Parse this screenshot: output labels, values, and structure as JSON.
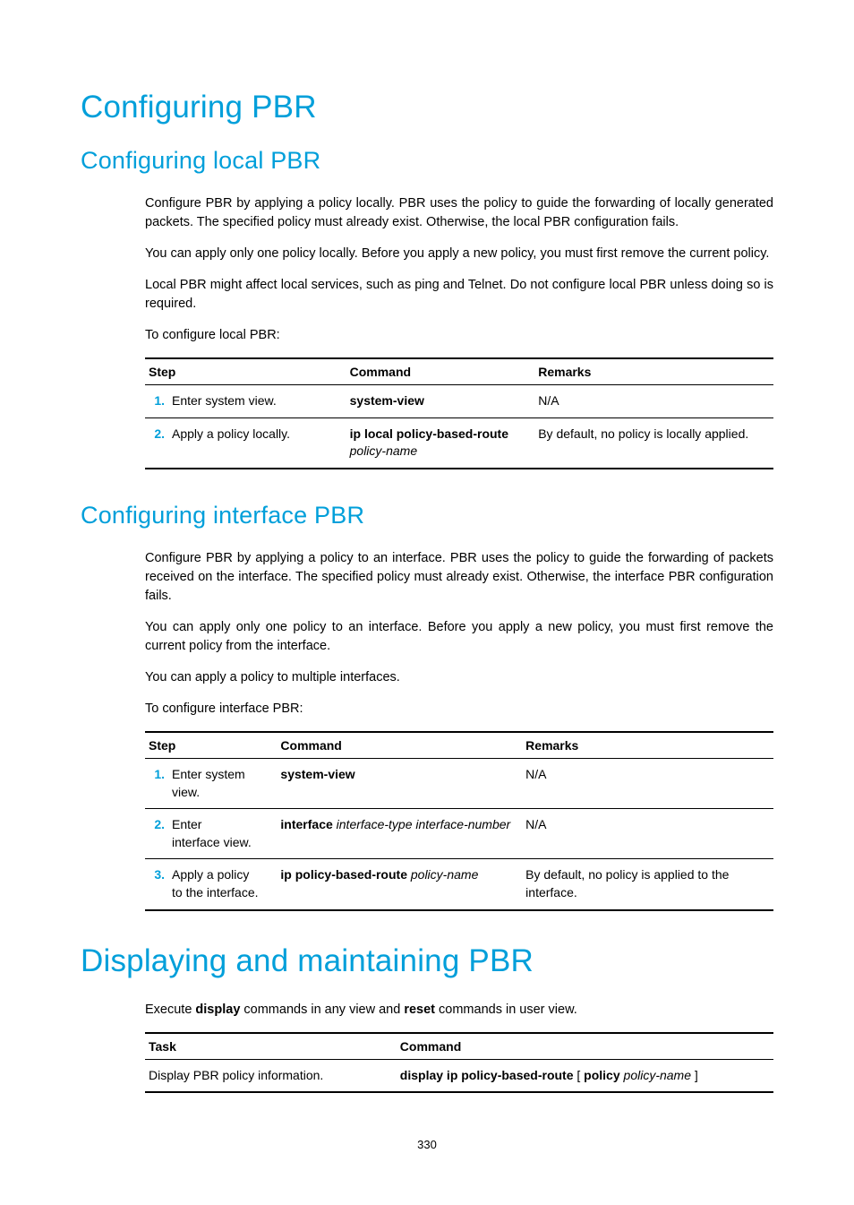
{
  "h1_main": "Configuring PBR",
  "sec1": {
    "heading": "Configuring local PBR",
    "p1": "Configure PBR by applying a policy locally. PBR uses the policy to guide the forwarding of locally generated packets. The specified policy must already exist. Otherwise, the local PBR configuration fails.",
    "p2": "You can apply only one policy locally. Before you apply a new policy, you must first remove the current policy.",
    "p3": "Local PBR might affect local services, such as ping and Telnet. Do not configure local PBR unless doing so is required.",
    "p4": "To configure local PBR:",
    "table": {
      "headers": {
        "c1": "Step",
        "c2": "Command",
        "c3": "Remarks"
      },
      "rows": [
        {
          "num": "1.",
          "step": "Enter system view.",
          "cmd_bold": "system-view",
          "cmd_ital": "",
          "remarks": "N/A"
        },
        {
          "num": "2.",
          "step": "Apply a policy locally.",
          "cmd_bold": "ip local policy-based-route",
          "cmd_ital": "policy-name",
          "remarks": "By default, no policy is locally applied."
        }
      ]
    }
  },
  "sec2": {
    "heading": "Configuring interface PBR",
    "p1": "Configure PBR by applying a policy to an interface. PBR uses the policy to guide the forwarding of packets received on the interface. The specified policy must already exist. Otherwise, the interface PBR configuration fails.",
    "p2": "You can apply only one policy to an interface. Before you apply a new policy, you must first remove the current policy from the interface.",
    "p3": "You can apply a policy to multiple interfaces.",
    "p4": "To configure interface PBR:",
    "table": {
      "headers": {
        "c1": "Step",
        "c2": "Command",
        "c3": "Remarks"
      },
      "rows": [
        {
          "num": "1.",
          "step": "Enter system view.",
          "cmd_bold": "system-view",
          "cmd_ital": "",
          "remarks": "N/A"
        },
        {
          "num": "2.",
          "step": "Enter interface view.",
          "cmd_bold": "interface",
          "cmd_ital": "interface-type interface-number",
          "remarks": "N/A"
        },
        {
          "num": "3.",
          "step": "Apply a policy to the interface.",
          "cmd_bold": "ip policy-based-route",
          "cmd_ital": "policy-name",
          "remarks": "By default, no policy is applied to the interface."
        }
      ]
    }
  },
  "h1_display": "Displaying and maintaining PBR",
  "display": {
    "intro_pre": "Execute ",
    "intro_b1": "display",
    "intro_mid": " commands in any view and ",
    "intro_b2": "reset",
    "intro_post": " commands in user view.",
    "table": {
      "headers": {
        "c1": "Task",
        "c2": "Command"
      },
      "row": {
        "task": "Display PBR policy information.",
        "cmd_b1": "display ip policy-based-route",
        "cmd_lit1": " [ ",
        "cmd_b2": "policy",
        "cmd_sp": " ",
        "cmd_ital": "policy-name",
        "cmd_lit2": " ]"
      }
    }
  },
  "page_number": "330"
}
